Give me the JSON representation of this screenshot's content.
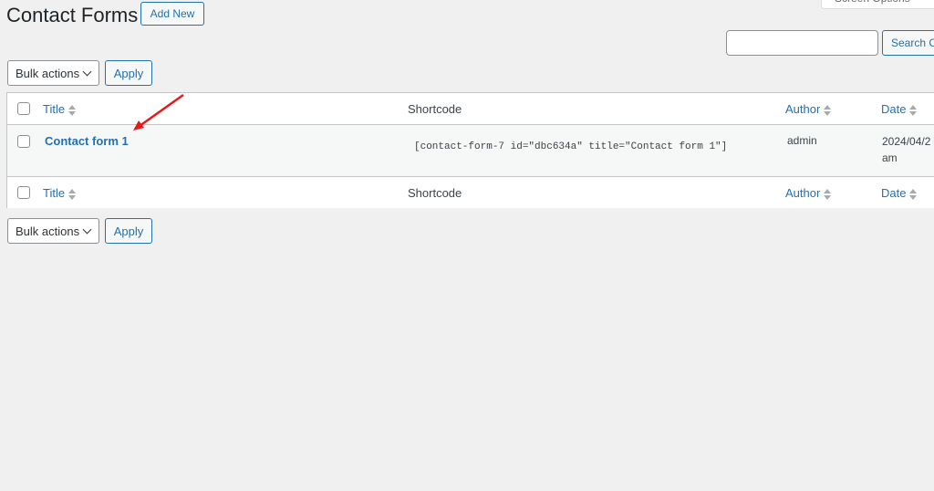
{
  "header": {
    "title": "Contact Forms",
    "add_new_label": "Add New",
    "screen_options_label": "Screen Options"
  },
  "search": {
    "value": "",
    "placeholder": "",
    "button_label": "Search Contact Forms"
  },
  "top_nav": {
    "bulk_actions_label": "Bulk actions",
    "apply_label": "Apply"
  },
  "bottom_nav": {
    "bulk_actions_label": "Bulk actions",
    "apply_label": "Apply"
  },
  "table": {
    "columns": [
      {
        "label": "Title",
        "sortable": true
      },
      {
        "label": "Shortcode",
        "sortable": false
      },
      {
        "label": "Author",
        "sortable": true
      },
      {
        "label": "Date",
        "sortable": true
      }
    ],
    "rows": [
      {
        "title": "Contact form 1",
        "shortcode": "[contact-form-7 id=\"dbc634a\" title=\"Contact form 1\"]",
        "author": "admin",
        "date_line1": "2024/04/2",
        "date_line2": "am"
      }
    ]
  },
  "annotation": {
    "arrow_color": "#e8191b"
  }
}
